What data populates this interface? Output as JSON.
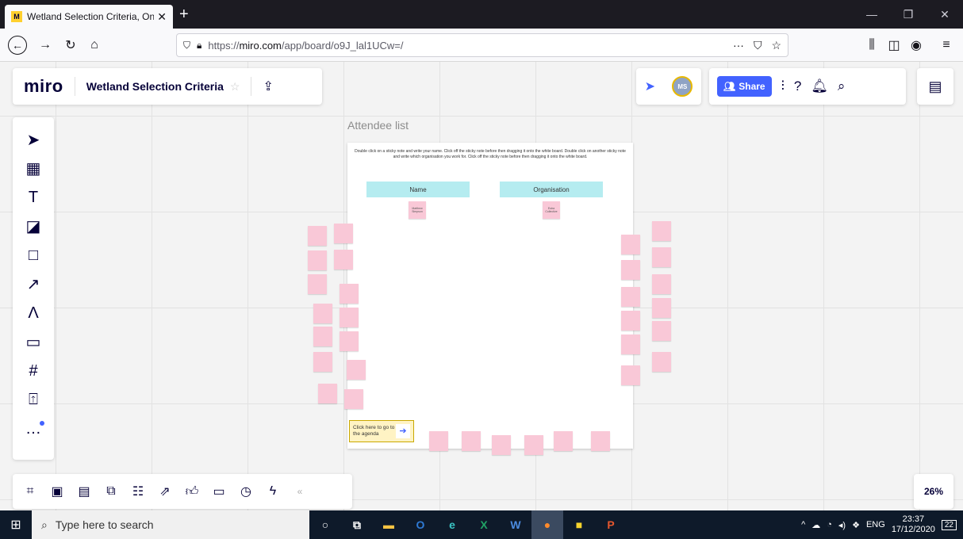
{
  "browser": {
    "tab_title": "Wetland Selection Criteria, Onli",
    "url_prefix": "https://",
    "url_host": "miro.com",
    "url_path": "/app/board/o9J_lal1UCw=/"
  },
  "miro": {
    "logo": "miro",
    "board_name": "Wetland Selection Criteria",
    "share_label": "Share",
    "avatar_initials": "MS",
    "zoom": "26%"
  },
  "frame": {
    "title": "Attendee list",
    "instructions": "Double click on a sticky note and write your name. Click off the sticky note before then dragging it onto the white board. Double click on another sticky note and write which organisation you work for. Click off the sticky note before then dragging it onto the white board.",
    "columns": [
      "Name",
      "Organisation"
    ],
    "name_sticky": "Matthew Simpson",
    "org_sticky": "Estra Collective",
    "agenda_button": "Click here to go to the agenda"
  },
  "taskbar": {
    "search_placeholder": "Type here to search",
    "language": "ENG",
    "time": "23:37",
    "date": "17/12/2020",
    "notification_count": "22"
  },
  "colors": {
    "miro_blue": "#4262ff",
    "sticky_pink": "#f9c8d7",
    "header_cyan": "#b5ecf0"
  }
}
